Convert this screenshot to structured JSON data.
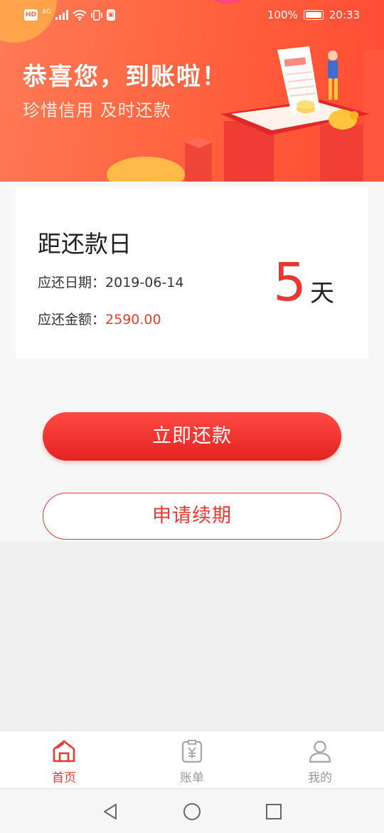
{
  "status_bar": {
    "battery": "100%",
    "time": "20:33",
    "network": "4G"
  },
  "banner": {
    "title": "恭喜您，到账啦！",
    "subtitle": "珍惜信用 及时还款"
  },
  "card": {
    "title": "距还款日",
    "due_date_label": "应还日期：",
    "due_date": "2019-06-14",
    "amount_label": "应还金额：",
    "amount": "2590.00",
    "days": "5",
    "days_unit": "天"
  },
  "actions": {
    "repay": "立即还款",
    "renew": "申请续期"
  },
  "tabs": [
    {
      "label": "首页",
      "icon": "home-icon",
      "active": true
    },
    {
      "label": "账单",
      "icon": "bill-icon",
      "active": false
    },
    {
      "label": "我的",
      "icon": "profile-icon",
      "active": false
    }
  ],
  "colors": {
    "accent": "#e53935",
    "banner": "#ff6a45"
  }
}
